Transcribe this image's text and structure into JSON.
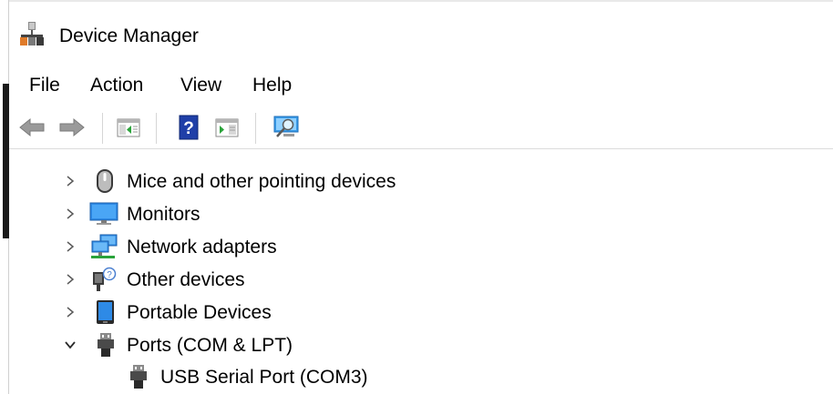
{
  "window": {
    "title": "Device Manager",
    "title_icon": "device-manager-icon"
  },
  "menu": {
    "items": [
      "File",
      "Action",
      "View",
      "Help"
    ]
  },
  "toolbar": {
    "buttons": [
      "back-arrow-icon",
      "forward-arrow-icon",
      "show-hide-console-tree-icon",
      "help-icon",
      "show-action-pane-icon",
      "scan-hardware-changes-icon"
    ]
  },
  "tree": {
    "rows": [
      {
        "label": "Mice and other pointing devices",
        "icon": "mouse-icon",
        "expanded": false
      },
      {
        "label": "Monitors",
        "icon": "monitor-icon",
        "expanded": false
      },
      {
        "label": "Network adapters",
        "icon": "network-adapter-icon",
        "expanded": false
      },
      {
        "label": "Other devices",
        "icon": "other-devices-icon",
        "expanded": false
      },
      {
        "label": "Portable Devices",
        "icon": "portable-device-icon",
        "expanded": false
      },
      {
        "label": "Ports (COM & LPT)",
        "icon": "port-icon",
        "expanded": true
      },
      {
        "label": "USB Serial Port (COM3)",
        "icon": "port-icon",
        "child": true
      }
    ]
  },
  "colors": {
    "separator": "#d6d6d6",
    "chevron": "#5a5a5a",
    "monitor_blue": "#2e8ae6"
  }
}
